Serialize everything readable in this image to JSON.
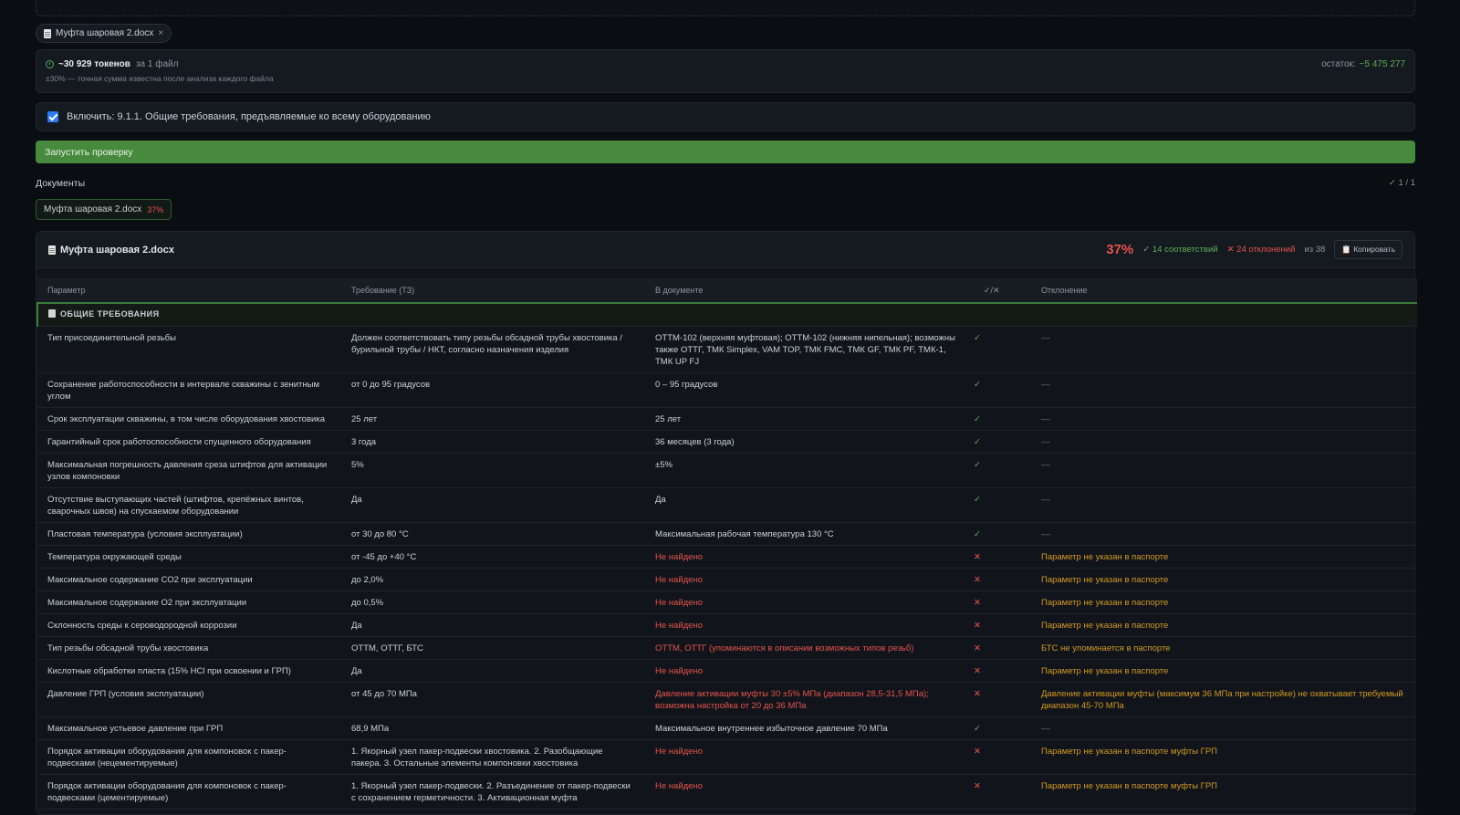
{
  "upload": {
    "file_name": "Муфта шаровая 2.docx",
    "remove_glyph": "×"
  },
  "tokens": {
    "count": "~30 929 токенов",
    "files": "за 1 файл",
    "remain_label": "остаток:",
    "remain_value": "~5 475 277",
    "note": "±30% — точная сумма известна после анализа каждого файла"
  },
  "include": {
    "label": "Включить: 9.1.1. Общие требования, предъявляемые ко всему оборудованию",
    "checked": true
  },
  "run_button": "Запустить проверку",
  "documents": {
    "heading": "Документы",
    "count_check": "✓",
    "count": "1 / 1",
    "tab_name": "Муфта шаровая 2.docx",
    "tab_pct": "37%"
  },
  "result": {
    "title": "Муфта шаровая 2.docx",
    "pct": "37%",
    "ok_count": "✓ 14 соответствий",
    "bad_count": "✕ 24 отклонений",
    "of_total": "из 38",
    "copy_label": "📋 Копировать",
    "columns": [
      "Параметр",
      "Требование (ТЗ)",
      "В документе",
      "✓/✕",
      "Отклонение"
    ],
    "section": "ОБЩИЕ ТРЕБОВАНИЯ",
    "rows": [
      {
        "param": "Тип присоединительной резьбы",
        "req": "Должен соответствовать типу резьбы обсадной трубы хвостовика / бурильной трубы / НКТ, согласно назначения изделия",
        "doc": "ОТТМ-102 (верхняя муфтовая); ОТТМ-102 (нижняя нипельная); возможны также ОТТГ, ТМК Simplex, VAM TOP, ТМК FMC, ТМК GF, ТМК PF, ТМК-1, ТМК UP FJ",
        "status": "ok",
        "mark": "✓",
        "dev": "—"
      },
      {
        "param": "Сохранение работоспособности в интервале скважины с зенитным углом",
        "req": "от 0 до 95 градусов",
        "doc": "0 – 95 градусов",
        "status": "ok",
        "mark": "✓",
        "dev": "—"
      },
      {
        "param": "Срок эксплуатации скважины, в том числе оборудования хвостовика",
        "req": "25 лет",
        "doc": "25 лет",
        "status": "ok",
        "mark": "✓",
        "dev": "—"
      },
      {
        "param": "Гарантийный срок работоспособности спущенного оборудования",
        "req": "3 года",
        "doc": "36 месяцев (3 года)",
        "status": "ok",
        "mark": "✓",
        "dev": "—"
      },
      {
        "param": "Максимальная погрешность давления среза штифтов для активации узлов компоновки",
        "req": "5%",
        "doc": "±5%",
        "status": "ok",
        "mark": "✓",
        "dev": "—"
      },
      {
        "param": "Отсутствие выступающих частей (штифтов, крепёжных винтов, сварочных швов) на спускаемом оборудовании",
        "req": "Да",
        "doc": "Да",
        "status": "ok",
        "mark": "✓",
        "dev": "—"
      },
      {
        "param": "Пластовая температура (условия эксплуатации)",
        "req": "от 30 до 80 °С",
        "doc": "Максимальная рабочая температура 130 °С",
        "status": "ok",
        "mark": "✓",
        "dev": "—"
      },
      {
        "param": "Температура окружающей среды",
        "req": "от -45 до +40 °С",
        "doc": "Не найдено",
        "status": "bad",
        "mark": "✕",
        "dev": "Параметр не указан в паспорте"
      },
      {
        "param": "Максимальное содержание СО2 при эксплуатации",
        "req": "до 2,0%",
        "doc": "Не найдено",
        "status": "bad",
        "mark": "✕",
        "dev": "Параметр не указан в паспорте"
      },
      {
        "param": "Максимальное содержание О2 при эксплуатации",
        "req": "до 0,5%",
        "doc": "Не найдено",
        "status": "bad",
        "mark": "✕",
        "dev": "Параметр не указан в паспорте"
      },
      {
        "param": "Склонность среды к сероводородной коррозии",
        "req": "Да",
        "doc": "Не найдено",
        "status": "bad",
        "mark": "✕",
        "dev": "Параметр не указан в паспорте"
      },
      {
        "param": "Тип резьбы обсадной трубы хвостовика",
        "req": "ОТТМ, ОТТГ, БТС",
        "doc": "ОТТМ, ОТТГ (упоминаются в описании возможных типов резьб)",
        "status": "bad",
        "mark": "✕",
        "dev": "БТС не упоминается в паспорте"
      },
      {
        "param": "Кислотные обработки пласта (15% HCl при освоении и ГРП)",
        "req": "Да",
        "doc": "Не найдено",
        "status": "bad",
        "mark": "✕",
        "dev": "Параметр не указан в паспорте"
      },
      {
        "param": "Давление ГРП (условия эксплуатации)",
        "req": "от 45 до 70 МПа",
        "doc": "Давление активации муфты 30 ±5% МПа (диапазон 28,5-31,5 МПа); возможна настройка от 20 до 36 МПа",
        "status": "bad",
        "mark": "✕",
        "dev": "Давление активации муфты (максимум 36 МПа при настройке) не охватывает требуемый диапазон 45-70 МПа"
      },
      {
        "param": "Максимальное устьевое давление при ГРП",
        "req": "68,9 МПа",
        "doc": "Максимальное внутреннее избыточное давление 70 МПа",
        "status": "ok",
        "mark": "✓",
        "dev": "—"
      },
      {
        "param": "Порядок активации оборудования для компоновок с пакер-подвесками (нецементируемые)",
        "req": "1. Якорный узел пакер-подвески хвостовика. 2. Разобщающие пакера. 3. Остальные элементы компоновки хвостовика",
        "doc": "Не найдено",
        "status": "bad",
        "mark": "✕",
        "dev": "Параметр не указан в паспорте муфты ГРП"
      },
      {
        "param": "Порядок активации оборудования для компоновок с пакер-подвесками (цементируемые)",
        "req": "1. Якорный узел пакер-подвески. 2. Разъединение от пакер-подвески с сохранением герметичности. 3. Активационная муфта",
        "doc": "Не найдено",
        "status": "bad",
        "mark": "✕",
        "dev": "Параметр не указан в паспорте муфты ГРП"
      }
    ]
  }
}
